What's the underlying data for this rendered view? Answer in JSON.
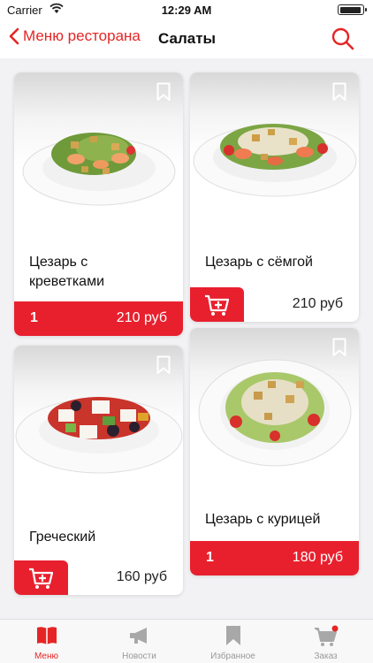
{
  "status_bar": {
    "carrier": "Carrier",
    "time": "12:29 AM",
    "battery_level": 0.9
  },
  "nav": {
    "back_label": "Меню ресторана",
    "title": "Салаты"
  },
  "colors": {
    "accent": "#e8202e",
    "tab_inactive": "#999999"
  },
  "cards": [
    {
      "name": "Цезарь с креветками",
      "quantity": "1",
      "price": "210 руб",
      "in_cart": true
    },
    {
      "name": "Цезарь с сёмгой",
      "price": "210 руб",
      "in_cart": false
    },
    {
      "name": "Греческий",
      "price": "160 руб",
      "in_cart": false
    },
    {
      "name": "Цезарь с курицей",
      "quantity": "1",
      "price": "180 руб",
      "in_cart": true
    }
  ],
  "tabs": [
    {
      "label": "Меню",
      "icon": "book-icon",
      "active": true
    },
    {
      "label": "Новости",
      "icon": "megaphone-icon",
      "active": false
    },
    {
      "label": "Избранное",
      "icon": "bookmark-icon",
      "active": false
    },
    {
      "label": "Заказ",
      "icon": "cart-icon",
      "active": false,
      "badge": true
    }
  ]
}
